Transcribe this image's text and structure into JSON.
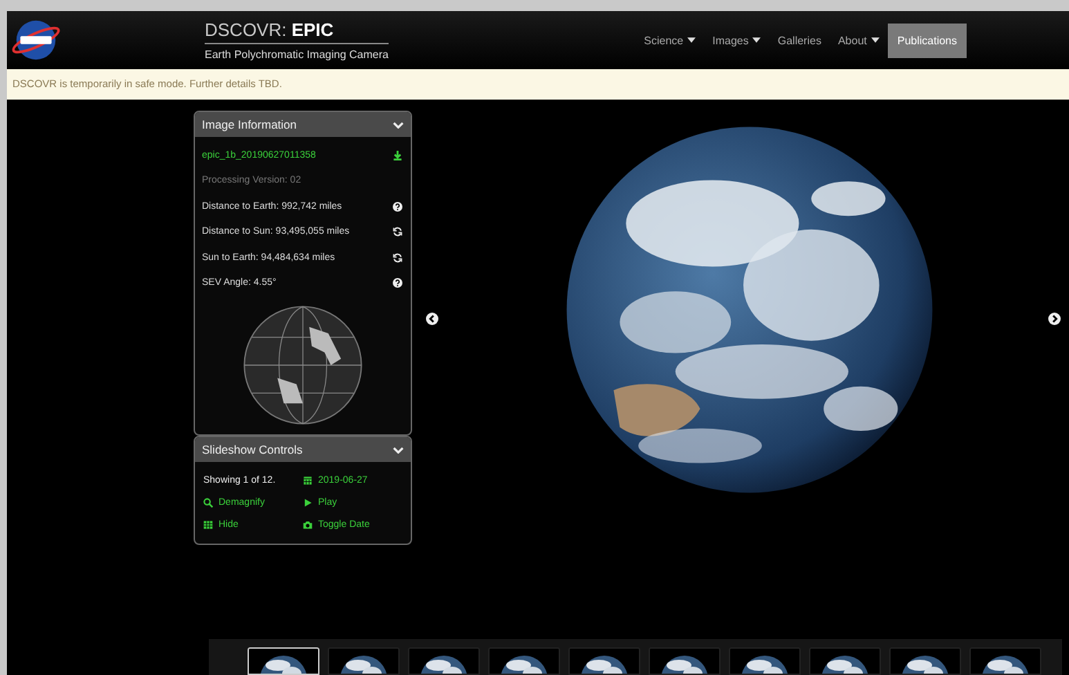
{
  "header": {
    "title_prefix": "DSCOVR:",
    "title_bold": "EPIC",
    "subtitle": "Earth Polychromatic Imaging Camera",
    "nav": [
      {
        "label": "Science",
        "dropdown": true,
        "selected": false
      },
      {
        "label": "Images",
        "dropdown": true,
        "selected": false
      },
      {
        "label": "Galleries",
        "dropdown": false,
        "selected": false
      },
      {
        "label": "About",
        "dropdown": true,
        "selected": false
      },
      {
        "label": "Publications",
        "dropdown": false,
        "selected": true
      }
    ]
  },
  "notice": "DSCOVR is temporarily in safe mode. Further details TBD.",
  "image_information": {
    "title": "Image Information",
    "filename": "epic_1b_20190627011358",
    "processing": "Processing Version: 02",
    "rows": [
      {
        "text": "Distance to Earth: 992,742 miles",
        "kind": "help"
      },
      {
        "text": "Distance to Sun: 93,495,055 miles",
        "kind": "refresh"
      },
      {
        "text": "Sun to Earth: 94,484,634 miles",
        "kind": "refresh"
      },
      {
        "text": "SEV Angle: 4.55°",
        "kind": "help"
      }
    ]
  },
  "slideshow_controls": {
    "title": "Slideshow Controls",
    "showing": "Showing 1 of 12.",
    "controls": [
      {
        "label": "2019-06-27",
        "kind": "calendar"
      },
      {
        "label": "Demagnify",
        "kind": "zoom"
      },
      {
        "label": "Play",
        "kind": "play"
      },
      {
        "label": "Hide",
        "kind": "grid"
      },
      {
        "label": "Toggle Date",
        "kind": "camera"
      }
    ]
  },
  "thumbnails": [
    {
      "selected": true
    },
    {
      "selected": false
    },
    {
      "selected": false
    },
    {
      "selected": false
    },
    {
      "selected": false
    },
    {
      "selected": false
    },
    {
      "selected": false
    },
    {
      "selected": false
    },
    {
      "selected": false
    },
    {
      "selected": false
    }
  ]
}
